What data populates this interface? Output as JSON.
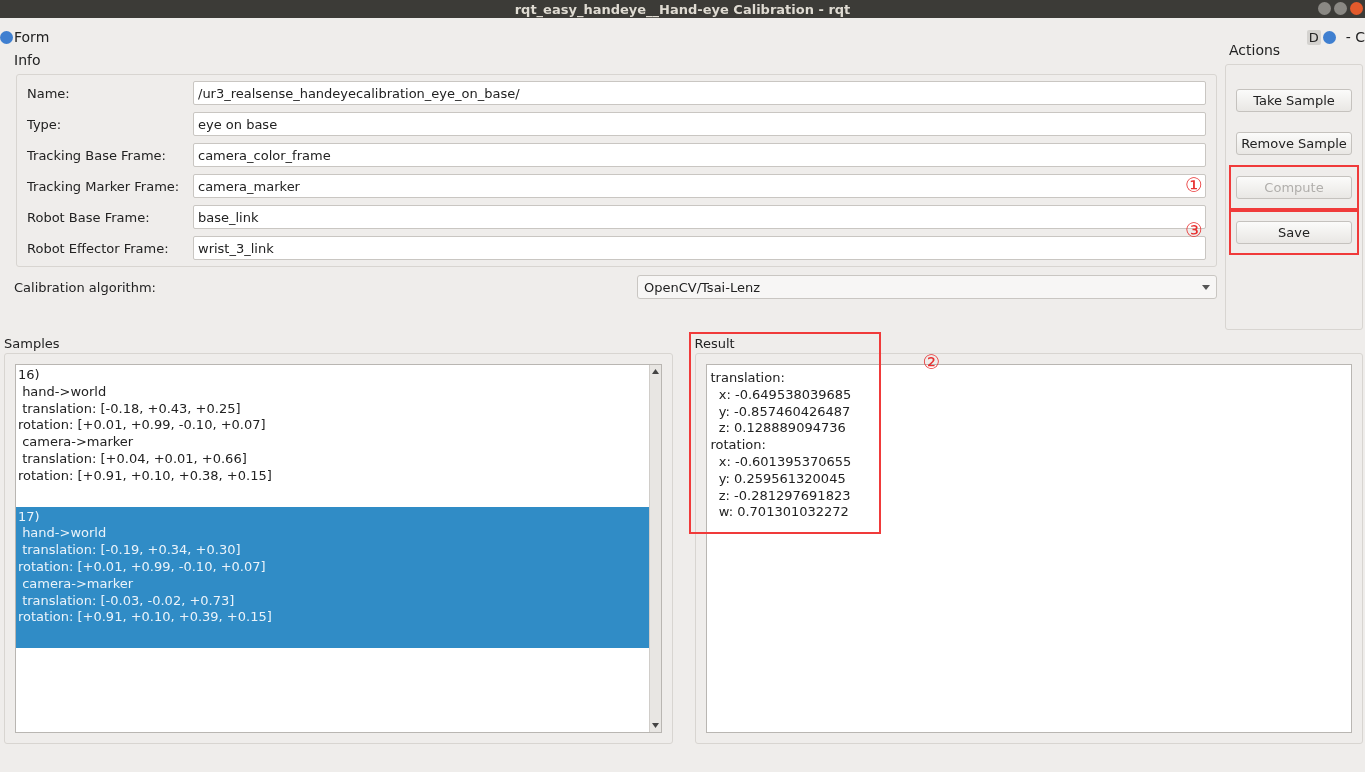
{
  "window": {
    "title": "rqt_easy_handeye__Hand-eye Calibration - rqt"
  },
  "header": {
    "title": "Form",
    "controls": [
      "D",
      "- C"
    ]
  },
  "info": {
    "title": "Info",
    "fields": [
      {
        "label": "Name:",
        "value": "/ur3_realsense_handeyecalibration_eye_on_base/"
      },
      {
        "label": "Type:",
        "value": "eye on base"
      },
      {
        "label": "Tracking Base Frame:",
        "value": "camera_color_frame"
      },
      {
        "label": "Tracking Marker Frame:",
        "value": "camera_marker"
      },
      {
        "label": "Robot Base Frame:",
        "value": "base_link"
      },
      {
        "label": "Robot Effector Frame:",
        "value": "wrist_3_link"
      }
    ]
  },
  "algorithm": {
    "label": "Calibration algorithm:",
    "value": "OpenCV/Tsai-Lenz"
  },
  "actions": {
    "title": "Actions",
    "buttons": [
      {
        "label": "Take Sample",
        "disabled": false,
        "highlighted": false
      },
      {
        "label": "Remove Sample",
        "disabled": false,
        "highlighted": false
      },
      {
        "label": "Compute",
        "disabled": true,
        "highlighted": true,
        "annotation": "①"
      },
      {
        "label": "Save",
        "disabled": false,
        "highlighted": true,
        "annotation": "③"
      }
    ]
  },
  "samples": {
    "title": "Samples",
    "items": [
      {
        "selected": false,
        "lines": [
          "16)",
          " hand->world",
          " translation: [-0.18, +0.43, +0.25]",
          "rotation: [+0.01, +0.99, -0.10, +0.07]",
          " camera->marker",
          " translation: [+0.04, +0.01, +0.66]",
          "rotation: [+0.91, +0.10, +0.38, +0.15]"
        ]
      },
      {
        "selected": true,
        "lines": [
          "17)",
          " hand->world",
          " translation: [-0.19, +0.34, +0.30]",
          "rotation: [+0.01, +0.99, -0.10, +0.07]",
          " camera->marker",
          " translation: [-0.03, -0.02, +0.73]",
          "rotation: [+0.91, +0.10, +0.39, +0.15]"
        ]
      }
    ]
  },
  "result": {
    "title": "Result",
    "highlighted": true,
    "annotation": "②",
    "lines": [
      "translation:",
      "  x: -0.649538039685",
      "  y: -0.857460426487",
      "  z: 0.128889094736",
      "rotation:",
      "  x: -0.601395370655",
      "  y: 0.259561320045",
      "  z: -0.281297691823",
      "  w: 0.701301032272"
    ]
  }
}
